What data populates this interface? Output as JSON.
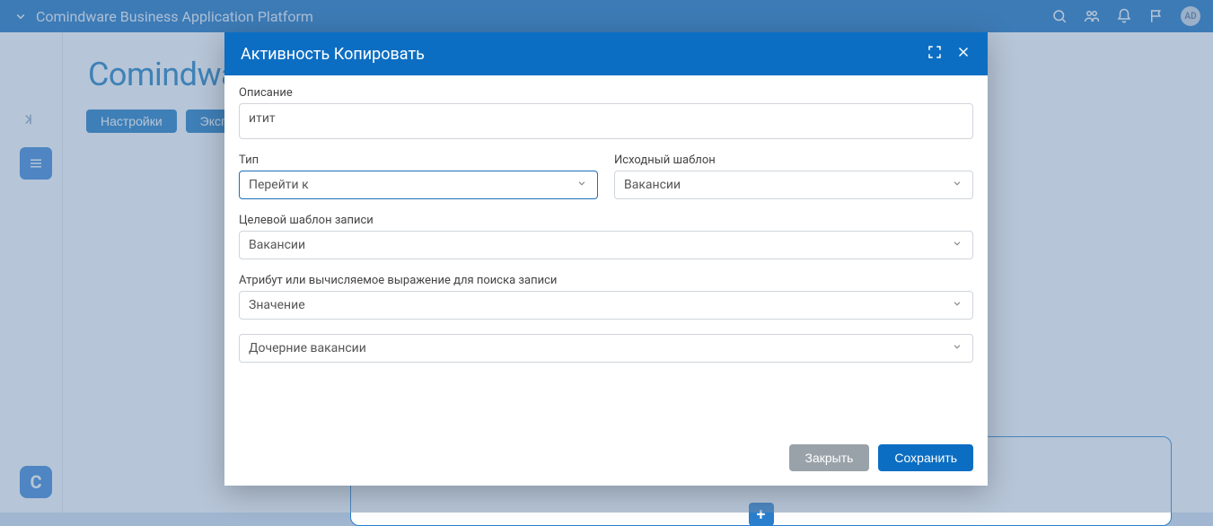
{
  "app": {
    "title": "Comindware Business Application Platform"
  },
  "header_icons": {
    "search": "search-icon",
    "people": "people-icon",
    "bell": "bell-icon",
    "flag": "flag-icon",
    "avatar_initials": "AD"
  },
  "brand": {
    "name": "Comindware",
    "reg": "®"
  },
  "tabs": {
    "settings": "Настройки",
    "export": "Экспорт"
  },
  "bg": {
    "plus": "+"
  },
  "burger": {
    "name": "menu-icon"
  },
  "corner": {
    "text": "C"
  },
  "modal": {
    "title": "Активность Копировать",
    "description": {
      "label": "Описание",
      "value": "итит"
    },
    "type": {
      "label": "Тип",
      "value": "Перейти к"
    },
    "source_template": {
      "label": "Исходный шаблон",
      "value": "Вакансии"
    },
    "target_template": {
      "label": "Целевой шаблон записи",
      "value": "Вакансии"
    },
    "attribute_expr": {
      "label": "Атрибут или вычисляемое выражение для поиска записи",
      "value": "Значение"
    },
    "extra_select": {
      "value": "Дочерние вакансии"
    },
    "footer": {
      "close": "Закрыть",
      "save": "Сохранить"
    }
  }
}
